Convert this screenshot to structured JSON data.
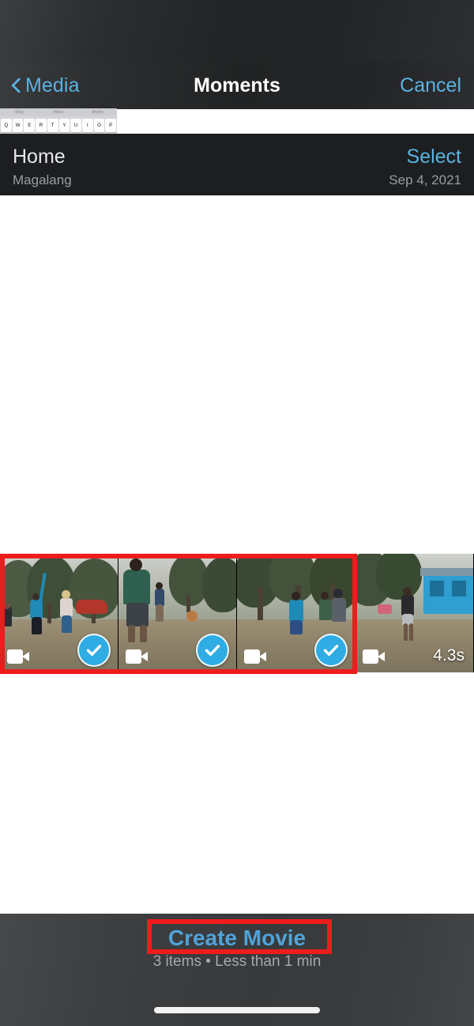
{
  "nav": {
    "back_label": "Media",
    "back_icon": "chevron-left-icon",
    "title": "Moments",
    "cancel_label": "Cancel",
    "accent_color": "#5ab3e0"
  },
  "keyboard_remnant": {
    "suggestions": [
      "Okay",
      "Hana",
      "Ahana"
    ],
    "keys": [
      "Q",
      "W",
      "E",
      "R",
      "T",
      "Y",
      "U",
      "I",
      "O",
      "P"
    ]
  },
  "sub_header": {
    "title": "Home",
    "subtitle": "Magalang",
    "select_label": "Select",
    "date": "Sep 4, 2021"
  },
  "strip": {
    "thumbnails": [
      {
        "icon": "video-camera-icon",
        "selected": true,
        "check_icon": "check-circle-icon",
        "duration": ""
      },
      {
        "icon": "video-camera-icon",
        "selected": true,
        "check_icon": "check-circle-icon",
        "duration": ""
      },
      {
        "icon": "video-camera-icon",
        "selected": true,
        "check_icon": "check-circle-icon",
        "duration": ""
      },
      {
        "icon": "video-camera-icon",
        "selected": false,
        "check_icon": "",
        "duration": "4.3s"
      }
    ],
    "check_color": "#30ace4"
  },
  "bottom": {
    "cta_label": "Create Movie",
    "summary": "3 items • Less than 1 min",
    "cta_color": "#4fa3d8"
  },
  "annotations": {
    "color": "#ee1c1c",
    "boxes": [
      "selected-thumbnails-highlight",
      "create-movie-highlight"
    ]
  }
}
